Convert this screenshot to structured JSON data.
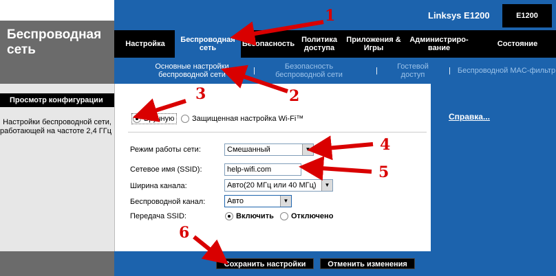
{
  "page": {
    "section_title": "Беспроводная сеть"
  },
  "header": {
    "model_name": "Linksys E1200",
    "model_badge": "E1200"
  },
  "tabs": [
    {
      "label": "Настройка"
    },
    {
      "label": "Беспроводная сеть"
    },
    {
      "label": "Безопасность"
    },
    {
      "label": "Политика доступа"
    },
    {
      "label": "Приложения & Игры"
    },
    {
      "label": "Администриро-вание"
    },
    {
      "label": "Состояние"
    }
  ],
  "subtabs": [
    {
      "label": "Основные настройки беспроводной сети"
    },
    {
      "label": "Безопасность беспроводной сети"
    },
    {
      "label": "Гостевой доступ"
    },
    {
      "label": "Беспроводной MAC-фильтр"
    }
  ],
  "separator": "|",
  "sidebar": {
    "header": "Просмотр конфигурации",
    "label": "Настройки беспроводной сети, работающей на частоте 2,4 ГГц"
  },
  "help": {
    "link": "Справка..."
  },
  "form": {
    "config_mode": {
      "manual": "Вручную",
      "wps": "Защищенная настройка Wi-Fi™"
    },
    "network_mode": {
      "label": "Режим работы сети:",
      "value": "Смешанный"
    },
    "ssid": {
      "label": "Сетевое имя (SSID):",
      "value": "help-wifi.com"
    },
    "channel_width": {
      "label": "Ширина канала:",
      "value": "Авто(20 МГц или 40 МГц)"
    },
    "channel": {
      "label": "Беспроводной канал:",
      "value": "Авто"
    },
    "ssid_broadcast": {
      "label": "Передача SSID:",
      "on": "Включить",
      "off": "Отключено"
    }
  },
  "buttons": {
    "save": "Сохранить настройки",
    "cancel": "Отменить изменения"
  },
  "annotations": [
    "1",
    "2",
    "3",
    "4",
    "5",
    "6"
  ],
  "colors": {
    "primary_blue": "#1c63ad",
    "annotation_red": "#d90000",
    "tabbar": "#000000",
    "sidebar_gray": "#6b6b6b"
  },
  "icons": {
    "dropdown": "dropdown-arrow-icon"
  }
}
